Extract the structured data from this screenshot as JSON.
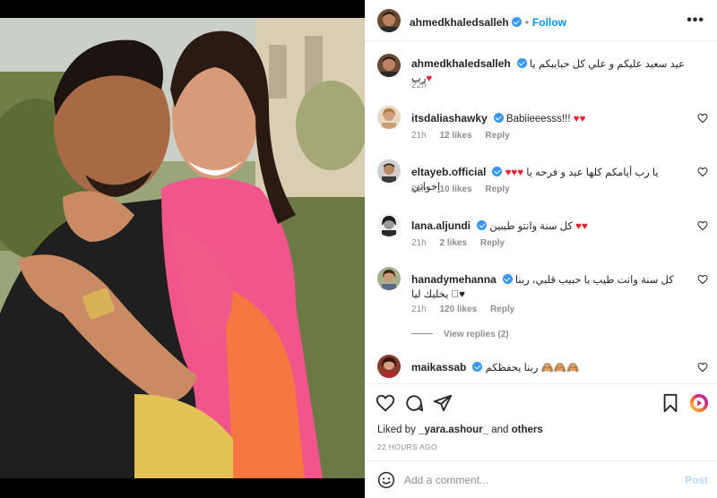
{
  "post": {
    "author": "ahmedkhaledsalleh",
    "follow_label": "Follow",
    "more_label": "•••",
    "caption": "عيد سعيد عليكم و علي كل حبايبكم يا رب",
    "caption_emoji": "♥",
    "caption_time": "22h"
  },
  "comments": [
    {
      "user": "itsdaliashawky",
      "text": "Babiieeesss!!!",
      "hearts": "♥♥",
      "time": "21h",
      "likes": "12 likes",
      "reply": "Reply"
    },
    {
      "user": "eltayeb.official",
      "text": "يا رب أيامكم كلها عيد و فرحه يا إخواتي",
      "hearts": "♥♥♥",
      "time": "21h",
      "likes": "10 likes",
      "reply": "Reply"
    },
    {
      "user": "lana.aljundi",
      "text": "كل سنة وانتو طيبين",
      "hearts": "♥♥",
      "time": "21h",
      "likes": "2 likes",
      "reply": "Reply"
    },
    {
      "user": "hanadymehanna",
      "text": "كل سنة وانت طيب يا حبيب قلبي، ربنا يخليك ليا",
      "hearts": "♥🏻",
      "time": "21h",
      "likes": "120 likes",
      "reply": "Reply",
      "view_replies": "View replies (2)"
    },
    {
      "user": "maikassab",
      "text": "ربنا يحفظكم",
      "hearts": "🙈🙈🙈"
    }
  ],
  "liked_by": {
    "prefix": "Liked by",
    "user": "_yara.ashour_",
    "and": "and",
    "others": "others"
  },
  "timestamp": "22 HOURS AGO",
  "add_comment": {
    "placeholder": "Add a comment...",
    "post_label": "Post"
  },
  "colors": {
    "accent": "#0095f6",
    "heart": "#ed1b2e",
    "text": "#262626",
    "muted": "#8e8e8e"
  },
  "icons": [
    "heart-icon",
    "comment-icon",
    "share-icon",
    "bookmark-icon",
    "reels-icon",
    "emoji-icon"
  ]
}
